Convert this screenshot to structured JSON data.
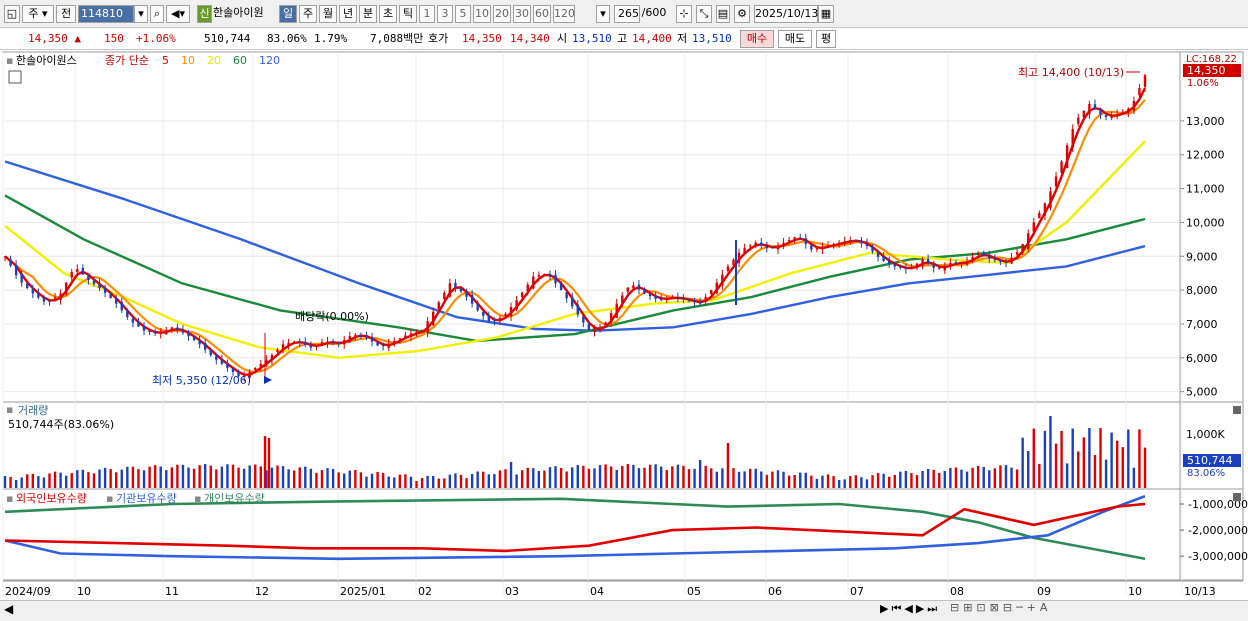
{
  "toolbar": {
    "market": "주",
    "prev_label": "전",
    "code": "114810",
    "badge": "신",
    "name": "한솔아이원",
    "periods": [
      "일",
      "주",
      "월",
      "년",
      "분",
      "초",
      "틱"
    ],
    "active_period": "일",
    "intervals": [
      "1",
      "3",
      "5",
      "10",
      "20",
      "30",
      "60",
      "120"
    ],
    "count": "265",
    "count_total": "/600",
    "date": "2025/10/13"
  },
  "quote": {
    "price": "14,350",
    "change": "150",
    "change_pct": "+1.06%",
    "volume": "510,744",
    "volume_ratio": "83.06%",
    "turnover_ratio": "1.79%",
    "amount": "7,088백만",
    "bid_label": "호가",
    "ask": "14,350",
    "bid": "14,340",
    "open_label": "시",
    "open": "13,510",
    "high_label": "고",
    "high": "14,400",
    "low_label": "저",
    "low": "13,510",
    "buy_label": "매수",
    "sell_label": "매도",
    "eval_label": "평"
  },
  "legend": {
    "stock_name": "한솔아이원스",
    "ma_label": "종가 단순",
    "ma_periods": [
      {
        "period": "5",
        "color": "#e00000"
      },
      {
        "period": "10",
        "color": "#ff8c00"
      },
      {
        "period": "20",
        "color": "#e8e800"
      },
      {
        "period": "60",
        "color": "#1a8a3a"
      },
      {
        "period": "120",
        "color": "#3060e0"
      }
    ]
  },
  "annotations": {
    "high": "최고 14,400 (10/13)",
    "low": "최저 5,350 (12/06)",
    "dividend": "배당락(0.00%)",
    "lc": "LC:168.22",
    "last_price": "14,350",
    "last_pct": "1.06%"
  },
  "volume_panel": {
    "title": "거래량",
    "value": "510,744주(83.06%)",
    "tick": "1,000K",
    "last": "510,744",
    "last_pct": "83.06%"
  },
  "holdings_panel": {
    "series": [
      "외국인보유수량",
      "기관보유수량",
      "개인보유수량"
    ],
    "colors": [
      "#e00000",
      "#3060e0",
      "#2e8b57"
    ],
    "ticks": [
      "-1,000,000",
      "-2,000,000",
      "-3,000,000"
    ]
  },
  "x_axis": [
    "2024/09",
    "10",
    "11",
    "12",
    "2025/01",
    "02",
    "03",
    "04",
    "05",
    "06",
    "07",
    "08",
    "09",
    "10",
    "10/13"
  ],
  "chart_data": {
    "type": "candlestick",
    "y_range": [
      4900,
      14800
    ],
    "y_ticks": [
      "13,000",
      "12,000",
      "11,000",
      "10,000",
      "9,000",
      "8,000",
      "7,000",
      "6,000",
      "5,000"
    ],
    "close_path": [
      [
        0,
        9000
      ],
      [
        5,
        8300
      ],
      [
        10,
        7900
      ],
      [
        15,
        7600
      ],
      [
        20,
        7900
      ],
      [
        25,
        8700
      ],
      [
        30,
        8300
      ],
      [
        35,
        8000
      ],
      [
        40,
        7600
      ],
      [
        45,
        7100
      ],
      [
        50,
        6800
      ],
      [
        55,
        6700
      ],
      [
        60,
        6900
      ],
      [
        65,
        6700
      ],
      [
        70,
        6400
      ],
      [
        75,
        6000
      ],
      [
        80,
        5700
      ],
      [
        85,
        5400
      ],
      [
        90,
        5700
      ],
      [
        95,
        6000
      ],
      [
        100,
        6400
      ],
      [
        105,
        6500
      ],
      [
        110,
        6300
      ],
      [
        115,
        6500
      ],
      [
        120,
        6400
      ],
      [
        125,
        6700
      ],
      [
        130,
        6600
      ],
      [
        135,
        6300
      ],
      [
        140,
        6500
      ],
      [
        145,
        6700
      ],
      [
        150,
        6800
      ],
      [
        155,
        7500
      ],
      [
        160,
        8200
      ],
      [
        165,
        7900
      ],
      [
        170,
        7400
      ],
      [
        175,
        7000
      ],
      [
        180,
        7300
      ],
      [
        185,
        7800
      ],
      [
        190,
        8400
      ],
      [
        195,
        8500
      ],
      [
        200,
        8000
      ],
      [
        205,
        7400
      ],
      [
        210,
        6800
      ],
      [
        215,
        6900
      ],
      [
        220,
        7600
      ],
      [
        225,
        8200
      ],
      [
        230,
        7900
      ],
      [
        235,
        7700
      ],
      [
        240,
        7800
      ],
      [
        245,
        7700
      ],
      [
        250,
        7600
      ],
      [
        255,
        8100
      ],
      [
        260,
        8700
      ],
      [
        265,
        9200
      ],
      [
        270,
        9400
      ],
      [
        275,
        9200
      ],
      [
        280,
        9400
      ],
      [
        285,
        9600
      ],
      [
        290,
        9200
      ],
      [
        295,
        9300
      ],
      [
        300,
        9400
      ],
      [
        305,
        9500
      ],
      [
        310,
        9300
      ],
      [
        315,
        8900
      ],
      [
        320,
        8700
      ],
      [
        325,
        8600
      ],
      [
        330,
        8900
      ],
      [
        335,
        8600
      ],
      [
        340,
        8800
      ],
      [
        345,
        8800
      ],
      [
        350,
        9100
      ],
      [
        355,
        8900
      ],
      [
        360,
        8800
      ],
      [
        365,
        9200
      ],
      [
        370,
        10000
      ],
      [
        375,
        10700
      ],
      [
        380,
        11800
      ],
      [
        385,
        13000
      ],
      [
        390,
        13500
      ],
      [
        395,
        13100
      ],
      [
        400,
        13200
      ],
      [
        405,
        13400
      ],
      [
        410,
        14350
      ]
    ],
    "ma_paths": {
      "ma120": [
        [
          0,
          11800
        ],
        [
          60,
          10700
        ],
        [
          120,
          9500
        ],
        [
          180,
          8200
        ],
        [
          230,
          7200
        ],
        [
          270,
          6850
        ],
        [
          300,
          6800
        ],
        [
          340,
          6900
        ],
        [
          380,
          7300
        ],
        [
          420,
          7800
        ],
        [
          460,
          8200
        ],
        [
          500,
          8450
        ],
        [
          540,
          8700
        ],
        [
          580,
          9300
        ]
      ],
      "ma60": [
        [
          0,
          10800
        ],
        [
          40,
          9500
        ],
        [
          90,
          8200
        ],
        [
          140,
          7400
        ],
        [
          200,
          6900
        ],
        [
          240,
          6500
        ],
        [
          290,
          6700
        ],
        [
          340,
          7400
        ],
        [
          380,
          7800
        ],
        [
          420,
          8400
        ],
        [
          460,
          8900
        ],
        [
          500,
          9100
        ],
        [
          540,
          9500
        ],
        [
          580,
          10100
        ]
      ],
      "ma20": [
        [
          0,
          9900
        ],
        [
          30,
          8500
        ],
        [
          60,
          7800
        ],
        [
          90,
          7000
        ],
        [
          130,
          6300
        ],
        [
          170,
          6000
        ],
        [
          210,
          6200
        ],
        [
          250,
          6600
        ],
        [
          290,
          7300
        ],
        [
          330,
          7600
        ],
        [
          360,
          7700
        ],
        [
          400,
          8500
        ],
        [
          440,
          9100
        ],
        [
          480,
          8900
        ],
        [
          510,
          8800
        ],
        [
          540,
          10000
        ],
        [
          580,
          12400
        ]
      ]
    },
    "indicators": {
      "foreign": [
        [
          0,
          -2400000
        ],
        [
          40,
          -2500000
        ],
        [
          80,
          -2600000
        ],
        [
          110,
          -2700000
        ],
        [
          150,
          -2700000
        ],
        [
          180,
          -2800000
        ],
        [
          210,
          -2600000
        ],
        [
          240,
          -2000000
        ],
        [
          270,
          -1900000
        ],
        [
          310,
          -2100000
        ],
        [
          330,
          -2200000
        ],
        [
          345,
          -1200000
        ],
        [
          370,
          -1800000
        ],
        [
          400,
          -1100000
        ],
        [
          410,
          -1000000
        ]
      ],
      "institution": [
        [
          0,
          -2400000
        ],
        [
          20,
          -2900000
        ],
        [
          60,
          -3000000
        ],
        [
          120,
          -3100000
        ],
        [
          200,
          -3000000
        ],
        [
          240,
          -2900000
        ],
        [
          280,
          -2800000
        ],
        [
          320,
          -2700000
        ],
        [
          350,
          -2500000
        ],
        [
          375,
          -2200000
        ],
        [
          395,
          -1300000
        ],
        [
          410,
          -700000
        ]
      ],
      "individual": [
        [
          0,
          -1300000
        ],
        [
          60,
          -1000000
        ],
        [
          120,
          -900000
        ],
        [
          200,
          -800000
        ],
        [
          260,
          -1100000
        ],
        [
          300,
          -1000000
        ],
        [
          330,
          -1300000
        ],
        [
          350,
          -1700000
        ],
        [
          370,
          -2300000
        ],
        [
          395,
          -2800000
        ],
        [
          410,
          -3100000
        ]
      ]
    }
  }
}
